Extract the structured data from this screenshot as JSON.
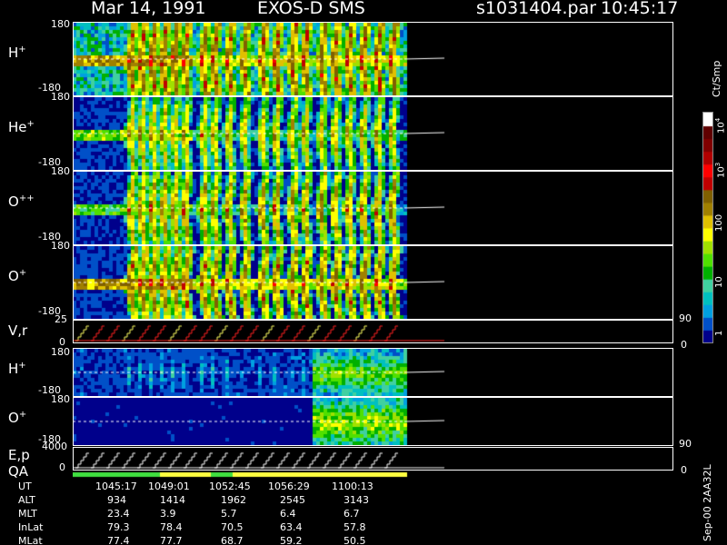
{
  "header": {
    "date": "Mar 14, 1991",
    "mission": "EXOS-D SMS",
    "file": "s1031404.par",
    "time": "10:45:17"
  },
  "panels": [
    {
      "label": "H",
      "charge": "+",
      "ymax": "180",
      "ymin": "-180"
    },
    {
      "label": "He",
      "charge": "+",
      "ymax": "180",
      "ymin": "-180"
    },
    {
      "label": "O",
      "charge": "++",
      "ymax": "180",
      "ymin": "-180"
    },
    {
      "label": "O",
      "charge": "+",
      "ymax": "180",
      "ymin": "-180"
    }
  ],
  "line_panels": [
    {
      "label": "V,r",
      "ymax": "25",
      "ymin": "0",
      "right_top": "90",
      "right_bottom": "0"
    },
    {
      "label": "E,p",
      "ymax": "4000",
      "ymin": "0",
      "right_top": "90",
      "right_bottom": "0",
      "sub_label": "QA"
    }
  ],
  "lower_panels": [
    {
      "label": "H",
      "charge": "+",
      "ymax": "180",
      "ymin": "-180"
    },
    {
      "label": "O",
      "charge": "+",
      "ymax": "180",
      "ymin": "-180"
    }
  ],
  "colorbar": {
    "unit": "Ct/Smp",
    "ticks": [
      "1",
      "10",
      "100",
      "10",
      "10"
    ],
    "tick_exponents": [
      "",
      "",
      "",
      "3",
      "4"
    ],
    "colors": [
      "#00008b",
      "#0050c8",
      "#00a0e0",
      "#00c0c0",
      "#40d0a0",
      "#00b000",
      "#50e000",
      "#a0e000",
      "#ffff00",
      "#e0c000",
      "#a08000",
      "#806000",
      "#c00000",
      "#ff0000",
      "#b00000",
      "#800000",
      "#600000",
      "#ffffff"
    ]
  },
  "footer": {
    "rows": [
      {
        "name": "UT",
        "values": [
          "1045:17",
          "1049:01",
          "1052:45",
          "1056:29",
          "1100:13"
        ]
      },
      {
        "name": "ALT",
        "values": [
          "934",
          "1414",
          "1962",
          "2545",
          "3143"
        ]
      },
      {
        "name": "MLT",
        "values": [
          "23.4",
          "3.9",
          "5.7",
          "6.4",
          "6.7"
        ]
      },
      {
        "name": "InLat",
        "values": [
          "79.3",
          "78.4",
          "70.5",
          "63.4",
          "57.8"
        ]
      },
      {
        "name": "MLat",
        "values": [
          "77.4",
          "77.7",
          "68.7",
          "59.2",
          "50.5"
        ]
      }
    ],
    "stamp": "Sep-00 2AA32L"
  },
  "chart_data": {
    "type": "heatmap",
    "title": "Mar 14, 1991   EXOS-D SMS",
    "x_tick_labels_UT": [
      "1045:17",
      "1049:01",
      "1052:45",
      "1056:29",
      "1100:13"
    ],
    "ylim": [
      -180,
      180
    ],
    "colorbar_unit": "Ct/Smp",
    "color_scale": "log",
    "colorbar_range": [
      1,
      10000
    ],
    "series": [
      {
        "name": "H+",
        "ylim": [
          -180,
          180
        ]
      },
      {
        "name": "He+",
        "ylim": [
          -180,
          180
        ]
      },
      {
        "name": "O++",
        "ylim": [
          -180,
          180
        ]
      },
      {
        "name": "O+",
        "ylim": [
          -180,
          180
        ]
      },
      {
        "name": "V,r",
        "ylim": [
          0,
          25
        ]
      },
      {
        "name": "H+",
        "ylim": [
          -180,
          180
        ]
      },
      {
        "name": "O+",
        "ylim": [
          -180,
          180
        ]
      },
      {
        "name": "E,p",
        "ylim": [
          0,
          4000
        ]
      }
    ]
  }
}
